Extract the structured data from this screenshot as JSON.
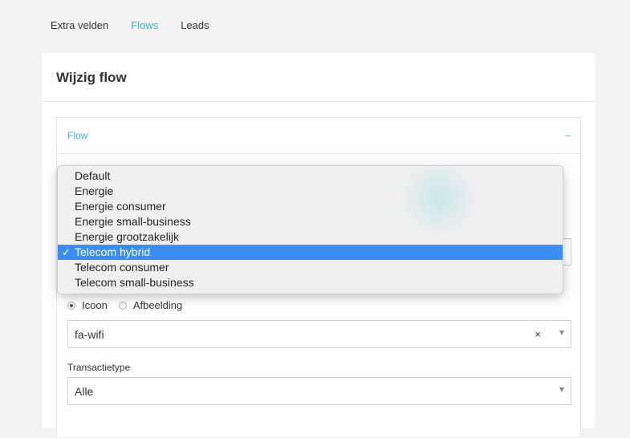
{
  "nav": {
    "items": [
      {
        "label": "Extra velden",
        "active": false
      },
      {
        "label": "Flows",
        "active": true
      },
      {
        "label": "Leads",
        "active": false
      }
    ]
  },
  "card": {
    "title": "Wijzig flow"
  },
  "panel": {
    "title": "Flow",
    "toggle": "–"
  },
  "dropdown": {
    "options": [
      "Default",
      "Energie",
      "Energie consumer",
      "Energie small-business",
      "Energie grootzakelijk",
      "Telecom hybrid",
      "Telecom consumer",
      "Telecom small-business"
    ],
    "selected_index": 5,
    "check_mark": "✓"
  },
  "media_type": {
    "options": [
      "Icoon",
      "Afbeelding"
    ],
    "selected": "Icoon"
  },
  "icon_select": {
    "value": "fa-wifi",
    "clear": "×"
  },
  "transaction": {
    "label": "Transactietype",
    "value": "Alle"
  },
  "colors": {
    "accent": "#2fb6c7",
    "selection": "#3b8df1"
  }
}
